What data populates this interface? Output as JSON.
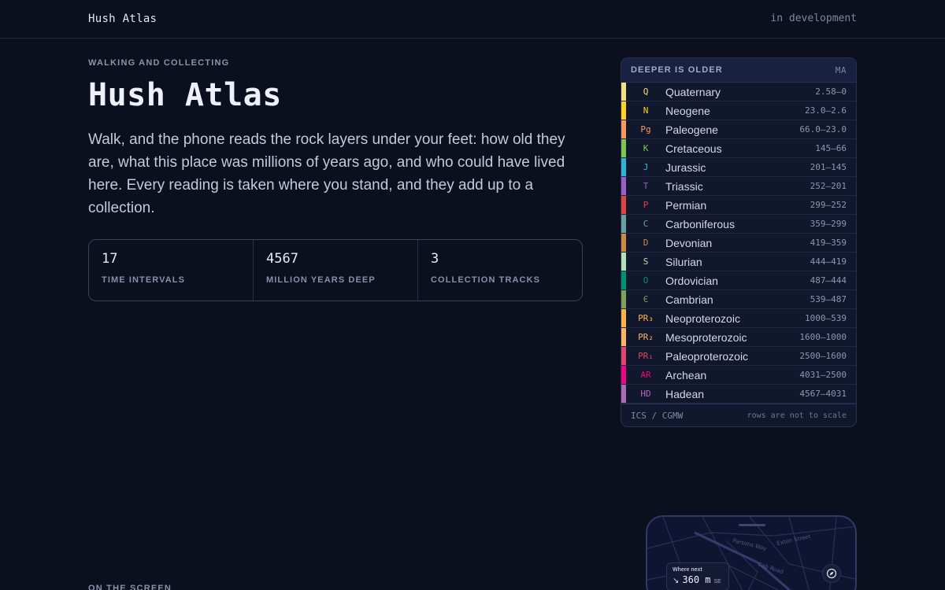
{
  "header": {
    "brand": "Hush Atlas",
    "status": "in development"
  },
  "hero": {
    "kicker": "WALKING AND COLLECTING",
    "title": "Hush Atlas",
    "description": "Walk, and the phone reads the rock layers under your feet: how old they are, what this place was millions of years ago, and who could have lived here. Every reading is taken where you stand, and they add up to a collection."
  },
  "stats": [
    {
      "value": "17",
      "label": "TIME INTERVALS"
    },
    {
      "value": "4567",
      "label": "MILLION YEARS DEEP"
    },
    {
      "value": "3",
      "label": "COLLECTION TRACKS"
    }
  ],
  "timescale": {
    "title": "DEEPER IS OLDER",
    "unit": "MA",
    "rows": [
      {
        "code": "Q",
        "name": "Quaternary",
        "range": "2.58–0",
        "color": "#f2e37a"
      },
      {
        "code": "N",
        "name": "Neogene",
        "range": "23.0–2.6",
        "color": "#ffd21f"
      },
      {
        "code": "Pg",
        "name": "Paleogene",
        "range": "66.0–23.0",
        "color": "#f79a5b"
      },
      {
        "code": "K",
        "name": "Cretaceous",
        "range": "145–66",
        "color": "#7fc64e"
      },
      {
        "code": "J",
        "name": "Jurassic",
        "range": "201–145",
        "color": "#2fb4d0"
      },
      {
        "code": "T",
        "name": "Triassic",
        "range": "252–201",
        "color": "#9a5fc4"
      },
      {
        "code": "P",
        "name": "Permian",
        "range": "299–252",
        "color": "#e0443a"
      },
      {
        "code": "C",
        "name": "Carboniferous",
        "range": "359–299",
        "color": "#67a0a0"
      },
      {
        "code": "D",
        "name": "Devonian",
        "range": "419–359",
        "color": "#cc8c3c"
      },
      {
        "code": "S",
        "name": "Silurian",
        "range": "444–419",
        "color": "#b3e1b6"
      },
      {
        "code": "O",
        "name": "Ordovician",
        "range": "487–444",
        "color": "#009270"
      },
      {
        "code": "Є",
        "name": "Cambrian",
        "range": "539–487",
        "color": "#7fa056"
      },
      {
        "code": "PR₃",
        "name": "Neoproterozoic",
        "range": "1000–539",
        "color": "#feb342"
      },
      {
        "code": "PR₂",
        "name": "Mesoproterozoic",
        "range": "1600–1000",
        "color": "#fdb462"
      },
      {
        "code": "PR₁",
        "name": "Paleoproterozoic",
        "range": "2500–1600",
        "color": "#e5426b"
      },
      {
        "code": "AR",
        "name": "Archean",
        "range": "4031–2500",
        "color": "#f0047f"
      },
      {
        "code": "HD",
        "name": "Hadean",
        "range": "4567–4031",
        "color": "#ae69b8"
      }
    ],
    "footer_left": "ICS / CGMW",
    "footer_right": "rows are not to scale"
  },
  "section": {
    "label": "ON THE SCREEN"
  },
  "phone": {
    "where_label": "Where next",
    "arrow": "↘",
    "distance": "360 m",
    "direction": "SE",
    "streets": [
      "Parsons Way",
      "Exton Street",
      "Cab Road"
    ],
    "compass_icon": "compass-icon"
  }
}
